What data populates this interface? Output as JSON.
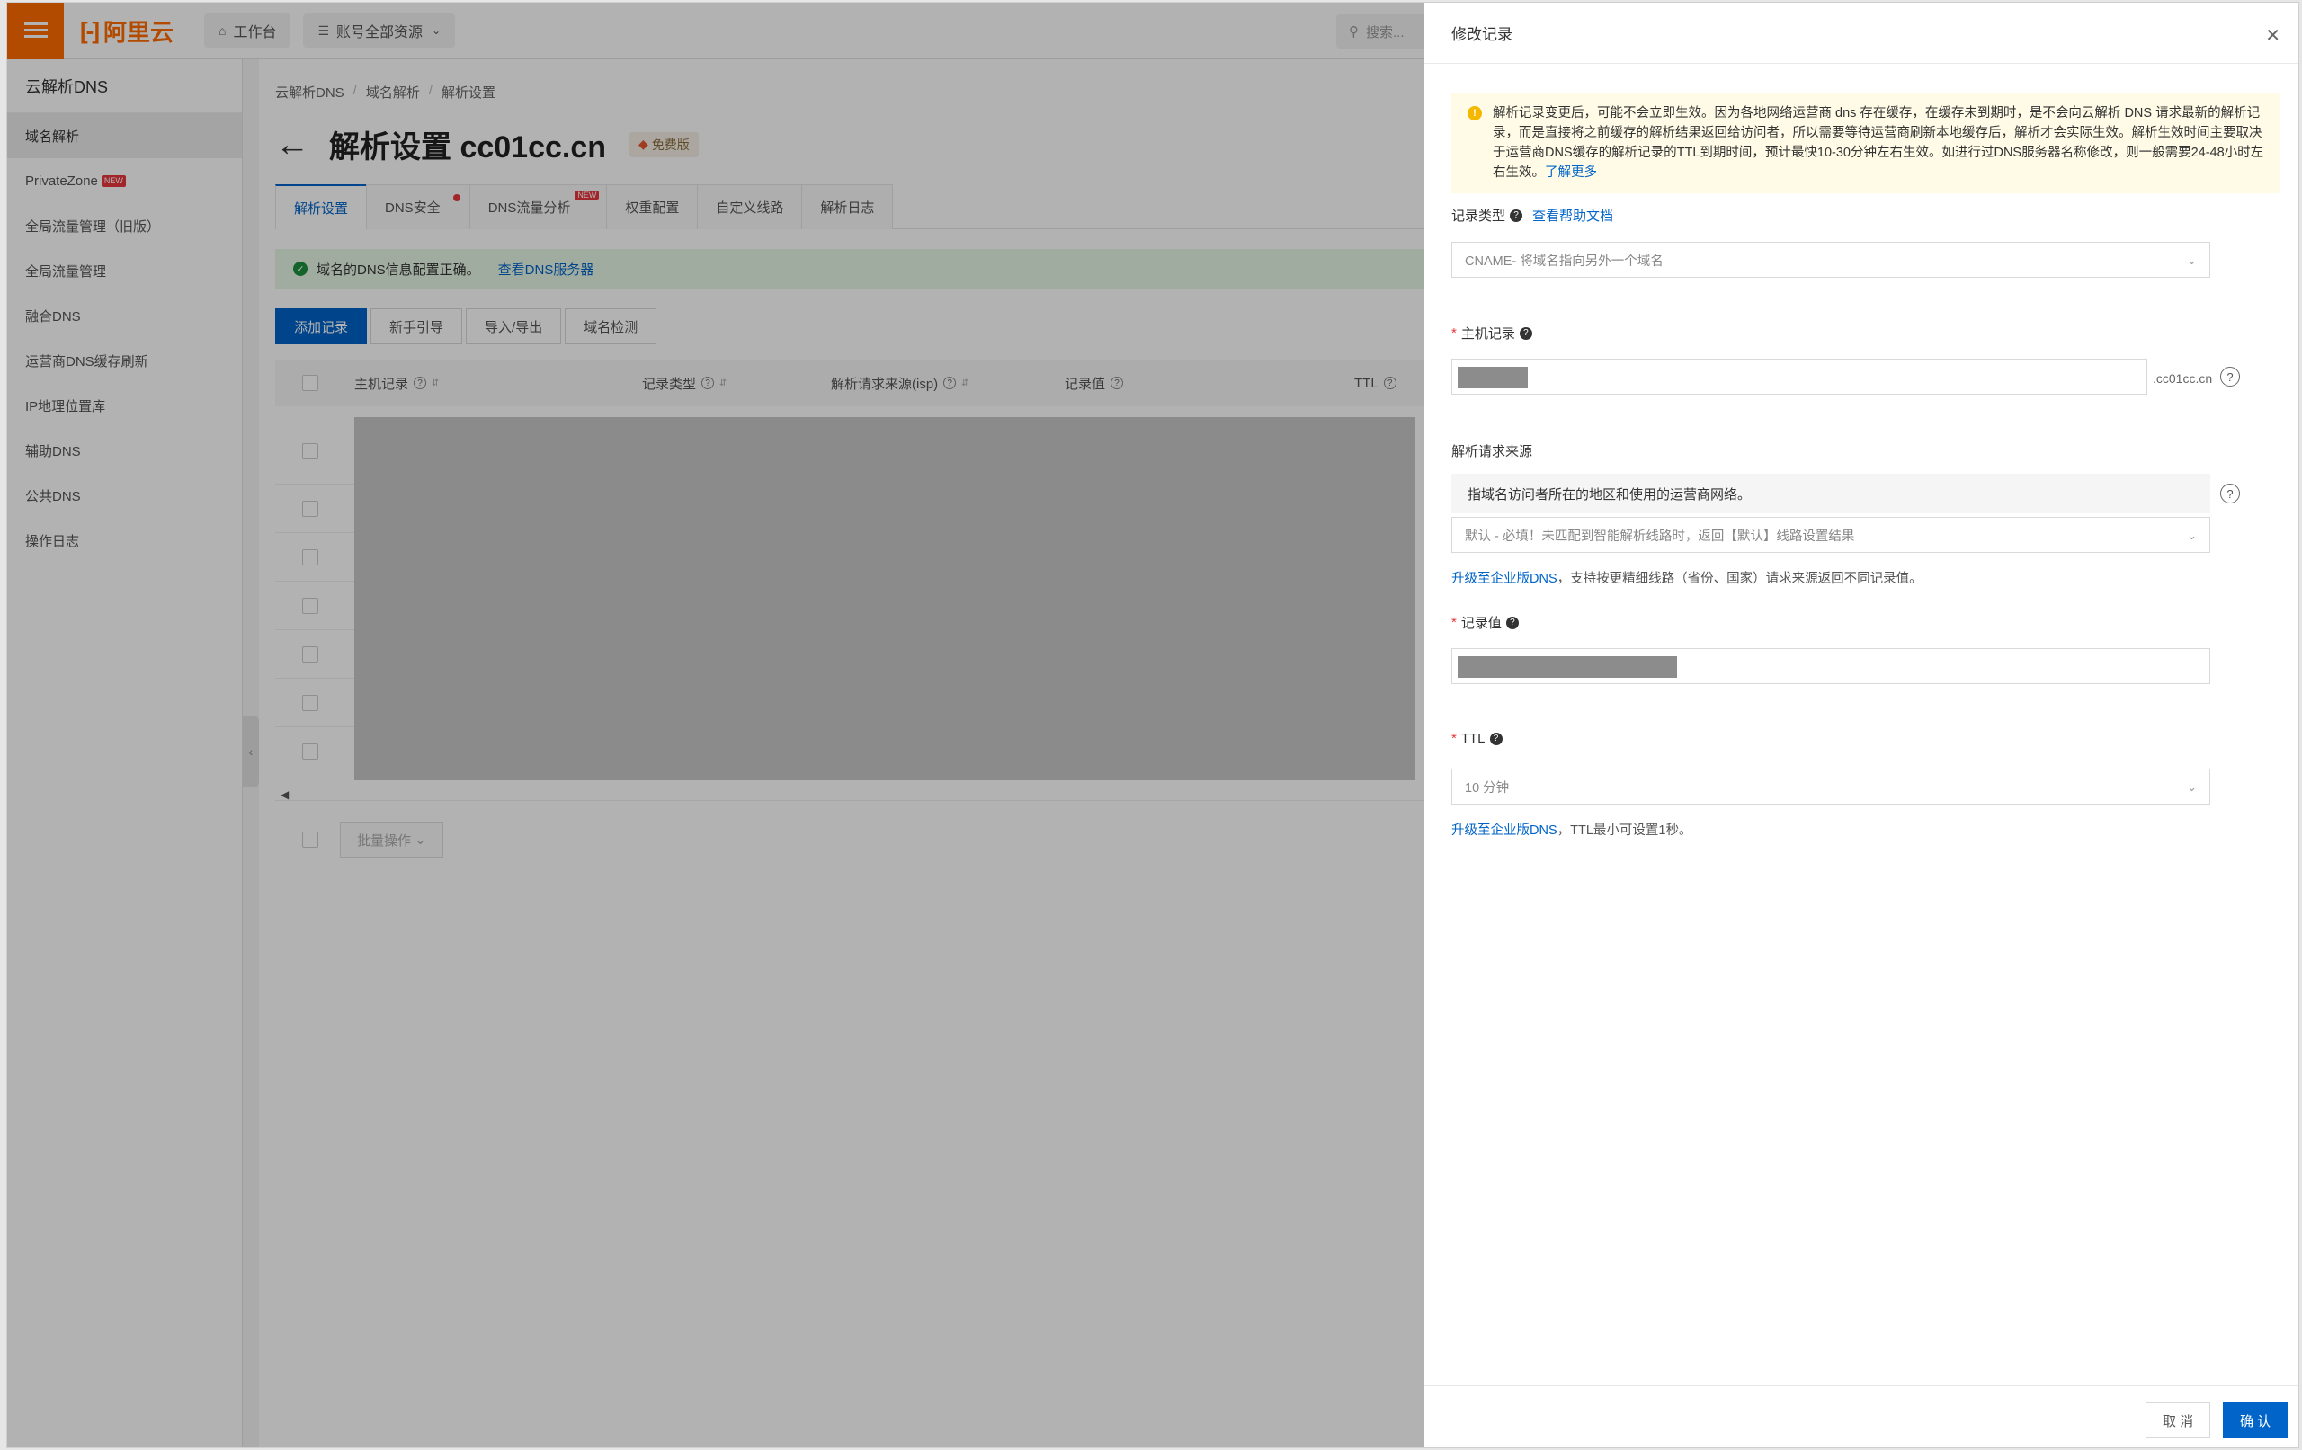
{
  "topbar": {
    "brand": "阿里云",
    "workbench": "工作台",
    "resources": "账号全部资源",
    "search_placeholder": "搜索..."
  },
  "sidebar": {
    "title": "云解析DNS",
    "items": [
      {
        "label": "域名解析",
        "active": true
      },
      {
        "label": "PrivateZone",
        "tag": "NEW"
      },
      {
        "label": "全局流量管理（旧版）"
      },
      {
        "label": "全局流量管理"
      },
      {
        "label": "融合DNS"
      },
      {
        "label": "运营商DNS缓存刷新"
      },
      {
        "label": "IP地理位置库"
      },
      {
        "label": "辅助DNS"
      },
      {
        "label": "公共DNS"
      },
      {
        "label": "操作日志"
      }
    ]
  },
  "main": {
    "breadcrumb": [
      "云解析DNS",
      "域名解析",
      "解析设置"
    ],
    "title": "解析设置 cc01cc.cn",
    "badge": "免费版",
    "tabs": [
      {
        "label": "解析设置"
      },
      {
        "label": "DNS安全"
      },
      {
        "label": "DNS流量分析",
        "tag": "NEW"
      },
      {
        "label": "权重配置"
      },
      {
        "label": "自定义线路"
      },
      {
        "label": "解析日志"
      }
    ],
    "alert_text": "域名的DNS信息配置正确。",
    "alert_link": "查看DNS服务器",
    "buttons": [
      "添加记录",
      "新手引导",
      "导入/导出",
      "域名检测"
    ],
    "columns": [
      "主机记录",
      "记录类型",
      "解析请求来源(isp)",
      "记录值",
      "TTL"
    ],
    "bulk_action": "批量操作"
  },
  "drawer": {
    "title": "修改记录",
    "warning": "解析记录变更后，可能不会立即生效。因为各地网络运营商 dns 存在缓存，在缓存未到期时，是不会向云解析 DNS 请求最新的解析记录，而是直接将之前缓存的解析结果返回给访问者，所以需要等待运营商刷新本地缓存后，解析才会实际生效。解析生效时间主要取决于运营商DNS缓存的解析记录的TTL到期时间，预计最快10-30分钟左右生效。如进行过DNS服务器名称修改，则一般需要24-48小时左右生效。",
    "warning_link": "了解更多",
    "record_type_label": "记录类型",
    "record_type_help": "查看帮助文档",
    "record_type_value": "CNAME- 将域名指向另外一个域名",
    "host_label": "主机记录",
    "host_suffix": ".cc01cc.cn",
    "source_label": "解析请求来源",
    "source_desc": "指域名访问者所在的地区和使用的运营商网络。",
    "source_value": "默认 - 必填！未匹配到智能解析线路时，返回【默认】线路设置结果",
    "source_note_link": "升级至企业版DNS",
    "source_note": "，支持按更精细线路（省份、国家）请求来源返回不同记录值。",
    "value_label": "记录值",
    "ttl_label": "TTL",
    "ttl_value": "10 分钟",
    "ttl_note_link": "升级至企业版DNS",
    "ttl_note": "，TTL最小可设置1秒。",
    "cancel": "取 消",
    "confirm": "确 认"
  }
}
